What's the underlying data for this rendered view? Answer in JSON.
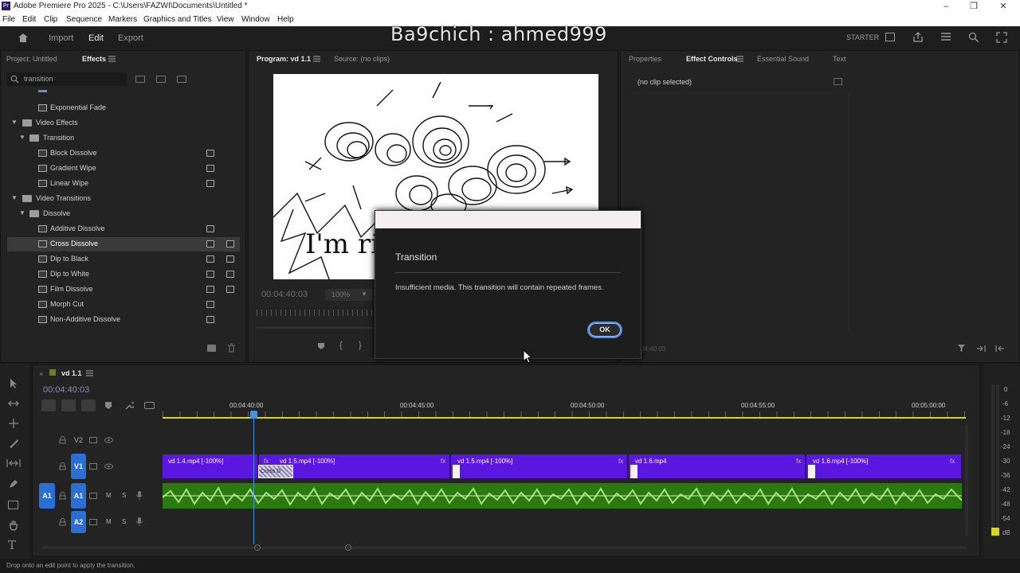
{
  "window": {
    "title": "Adobe Premiere Pro 2025 - C:\\Users\\FAZWI\\Documents\\Untitled *",
    "app_badge": "Pr"
  },
  "menu": [
    "File",
    "Edit",
    "Clip",
    "Sequence",
    "Markers",
    "Graphics and Titles",
    "View",
    "Window",
    "Help"
  ],
  "header": {
    "nav": [
      "Import",
      "Edit",
      "Export"
    ],
    "active_nav": "Edit",
    "watermark": "Ba9chich : ahmed999",
    "starter_label": "STARTER"
  },
  "effects_panel": {
    "tabs": [
      "Project: Untitled",
      "Effects"
    ],
    "active_tab": "Effects",
    "search_value": "transition",
    "tree": [
      {
        "label": "Exponential Fade",
        "level": 2,
        "kind": "effect",
        "badges": 1
      },
      {
        "label": "Video Effects",
        "level": 0,
        "kind": "folder"
      },
      {
        "label": "Transition",
        "level": 1,
        "kind": "folder"
      },
      {
        "label": "Block Dissolve",
        "level": 2,
        "kind": "effect",
        "badges": 1
      },
      {
        "label": "Gradient Wipe",
        "level": 2,
        "kind": "effect",
        "badges": 1
      },
      {
        "label": "Linear Wipe",
        "level": 2,
        "kind": "effect",
        "badges": 1
      },
      {
        "label": "Video Transitions",
        "level": 0,
        "kind": "folder"
      },
      {
        "label": "Dissolve",
        "level": 1,
        "kind": "folder"
      },
      {
        "label": "Additive Dissolve",
        "level": 2,
        "kind": "effect",
        "badges": 1
      },
      {
        "label": "Cross Dissolve",
        "level": 2,
        "kind": "effect",
        "badges": 2,
        "selected": true
      },
      {
        "label": "Dip to Black",
        "level": 2,
        "kind": "effect",
        "badges": 2
      },
      {
        "label": "Dip to White",
        "level": 2,
        "kind": "effect",
        "badges": 2
      },
      {
        "label": "Film Dissolve",
        "level": 2,
        "kind": "effect",
        "badges": 2
      },
      {
        "label": "Morph Cut",
        "level": 2,
        "kind": "effect",
        "badges": 1
      },
      {
        "label": "Non-Additive Dissolve",
        "level": 2,
        "kind": "effect",
        "badges": 1
      }
    ]
  },
  "program_monitor": {
    "tabs": [
      "Program: vd 1.1",
      "Source: (no clips)"
    ],
    "active_tab": "Program: vd 1.1",
    "timecode": "00:04:40:03",
    "zoom": "100%",
    "frame_text": "I'm rig"
  },
  "effect_controls": {
    "tabs": [
      "Properties",
      "Effect Controls",
      "Essential Sound",
      "Text"
    ],
    "active_tab": "Effect Controls",
    "status": "(no clip selected)",
    "timecode": "04:40:03"
  },
  "dialog": {
    "title": "Transition",
    "message": "Insufficient media. This transition will contain repeated frames.",
    "ok_label": "OK"
  },
  "timeline": {
    "sequence_name": "vd 1.1",
    "timecode": "00:04:40:03",
    "ruler_labels": [
      "00:04:40:00",
      "00:04:45:00",
      "00:04:50:00",
      "00:04:55:00",
      "00:05:00:00"
    ],
    "tracks": {
      "v2": "V2",
      "v1": "V1",
      "a1_src": "A1",
      "a1": "A1",
      "a2": "A2",
      "mute": "M",
      "solo": "S"
    },
    "clips": [
      {
        "label": "vd 1.4.mp4 [-100%]",
        "fx": ""
      },
      {
        "label": "vd 1.5.mp4 [-100%]",
        "fx": "fx"
      },
      {
        "label": "vd 1.5.mp4 [-100%]",
        "fx": "fx"
      },
      {
        "label": "vd 1.6.mp4",
        "fx": "fx"
      },
      {
        "label": "vd 1.6.mp4 [-100%]",
        "fx": "fx"
      }
    ],
    "transition_label": "Cross D"
  },
  "meters": {
    "labels": [
      "0",
      "-6",
      "-12",
      "-18",
      "-24",
      "-30",
      "-36",
      "-42",
      "-48",
      "-54"
    ],
    "unit": "dB"
  },
  "status_bar": "Drop onto an edit point to apply the transition.",
  "colors": {
    "video_clip": "#5b17e0",
    "audio_clip": "#2a7a10",
    "playhead": "#4a90e2",
    "work_area": "#d6d61a"
  }
}
